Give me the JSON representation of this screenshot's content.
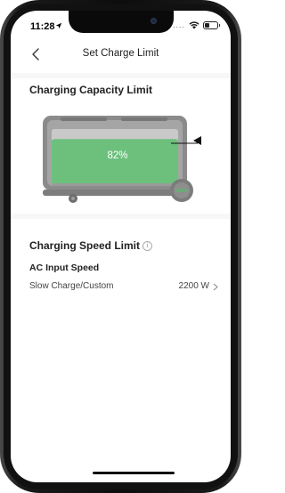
{
  "status_bar": {
    "time": "11:28",
    "signal_dots": "....",
    "icons": [
      "location-arrow-icon",
      "wifi-icon",
      "battery-icon"
    ]
  },
  "nav": {
    "title": "Set Charge Limit",
    "back_icon": "chevron-left-icon"
  },
  "capacity": {
    "title": "Charging Capacity Limit",
    "percent_label": "82%",
    "level": 0.82,
    "fill_color": "#6cc07c"
  },
  "speed": {
    "title": "Charging Speed Limit",
    "info_icon": "info-icon",
    "info_glyph": "i",
    "ac_title": "AC Input Speed",
    "row_label": "Slow Charge/Custom",
    "row_value": "2200 W"
  }
}
